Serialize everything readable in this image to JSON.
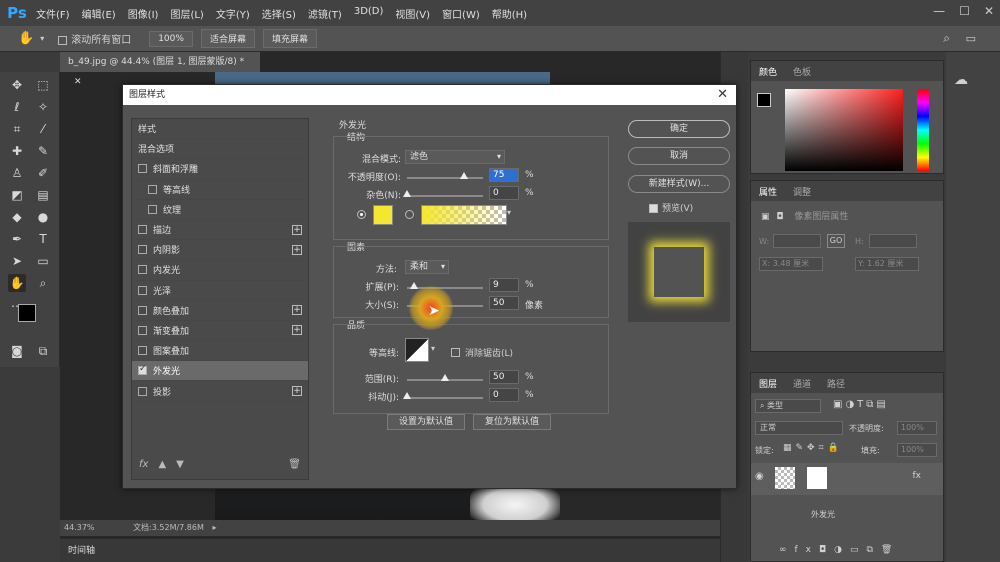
{
  "menubar": {
    "app_logo": "Ps",
    "items": [
      "文件(F)",
      "编辑(E)",
      "图像(I)",
      "图层(L)",
      "文字(Y)",
      "选择(S)",
      "滤镜(T)",
      "3D(D)",
      "视图(V)",
      "窗口(W)",
      "帮助(H)"
    ]
  },
  "options": {
    "scroll_all": "滚动所有窗口",
    "zoom": "100%",
    "fit_screen": "适合屏幕",
    "fill_screen": "填充屏幕"
  },
  "document": {
    "tab_title": "b_49.jpg @ 44.4% (图层 1, 图层蒙版/8) *",
    "zoom": "44.37%",
    "doc_size": "文档:3.52M/7.86M"
  },
  "timeline": {
    "label": "时间轴"
  },
  "panels": {
    "color_tabs": [
      "颜色",
      "色板"
    ],
    "props_tabs": [
      "属性",
      "调整"
    ],
    "props_title": "像素图层属性",
    "props_w_label": "W:",
    "props_h_label": "H:",
    "props_x": "X: 3.48 厘米",
    "props_y": "Y: 1.62 厘米",
    "layers_tabs": [
      "图层",
      "通道",
      "路径"
    ],
    "layers_kind": "类型",
    "layers_blend": "正常",
    "layers_opacity_label": "不透明度:",
    "layers_opacity": "100%",
    "layers_lock": "锁定:",
    "layers_fill_label": "填充:",
    "layers_fill": "100%",
    "layer_effect": "外发光"
  },
  "dialog": {
    "title": "图层样式",
    "styles": [
      {
        "label": "样式",
        "checkbox": false,
        "plus": false,
        "sub": false,
        "active": false
      },
      {
        "label": "混合选项",
        "checkbox": false,
        "plus": false,
        "sub": false,
        "active": false
      },
      {
        "label": "斜面和浮雕",
        "checkbox": true,
        "checked": false,
        "plus": false,
        "sub": false,
        "active": false
      },
      {
        "label": "等高线",
        "checkbox": true,
        "checked": false,
        "plus": false,
        "sub": true,
        "active": false
      },
      {
        "label": "纹理",
        "checkbox": true,
        "checked": false,
        "plus": false,
        "sub": true,
        "active": false
      },
      {
        "label": "描边",
        "checkbox": true,
        "checked": false,
        "plus": true,
        "sub": false,
        "active": false
      },
      {
        "label": "内阴影",
        "checkbox": true,
        "checked": false,
        "plus": true,
        "sub": false,
        "active": false
      },
      {
        "label": "内发光",
        "checkbox": true,
        "checked": false,
        "plus": false,
        "sub": false,
        "active": false
      },
      {
        "label": "光泽",
        "checkbox": true,
        "checked": false,
        "plus": false,
        "sub": false,
        "active": false
      },
      {
        "label": "颜色叠加",
        "checkbox": true,
        "checked": false,
        "plus": true,
        "sub": false,
        "active": false
      },
      {
        "label": "渐变叠加",
        "checkbox": true,
        "checked": false,
        "plus": true,
        "sub": false,
        "active": false
      },
      {
        "label": "图案叠加",
        "checkbox": true,
        "checked": false,
        "plus": false,
        "sub": false,
        "active": false
      },
      {
        "label": "外发光",
        "checkbox": true,
        "checked": true,
        "plus": false,
        "sub": false,
        "active": true
      },
      {
        "label": "投影",
        "checkbox": true,
        "checked": false,
        "plus": true,
        "sub": false,
        "active": false
      }
    ],
    "fx_label": "fx",
    "section_title": "外发光",
    "structure": {
      "title": "结构",
      "blend_mode_label": "混合模式:",
      "blend_mode": "滤色",
      "opacity_label": "不透明度(O):",
      "opacity": "75",
      "opacity_fraction": 0.75,
      "noise_label": "杂色(N):",
      "noise": "0",
      "noise_fraction": 0,
      "percent": "%",
      "glow_color": "#f5e631"
    },
    "elements": {
      "title": "图素",
      "technique_label": "方法:",
      "technique": "柔和",
      "spread_label": "扩展(P):",
      "spread": "9",
      "spread_fraction": 0.09,
      "size_label": "大小(S):",
      "size": "50",
      "size_fraction": 0.2,
      "size_unit": "像素",
      "percent": "%"
    },
    "quality": {
      "title": "品质",
      "contour_label": "等高线:",
      "anti_alias": "消除锯齿(L)",
      "range_label": "范围(R):",
      "range": "50",
      "range_fraction": 0.5,
      "jitter_label": "抖动(J):",
      "jitter": "0",
      "jitter_fraction": 0,
      "percent": "%"
    },
    "set_default": "设置为默认值",
    "reset_default": "复位为默认值",
    "ok": "确定",
    "cancel": "取消",
    "new_style": "新建样式(W)...",
    "preview_label": "预览(V)"
  }
}
